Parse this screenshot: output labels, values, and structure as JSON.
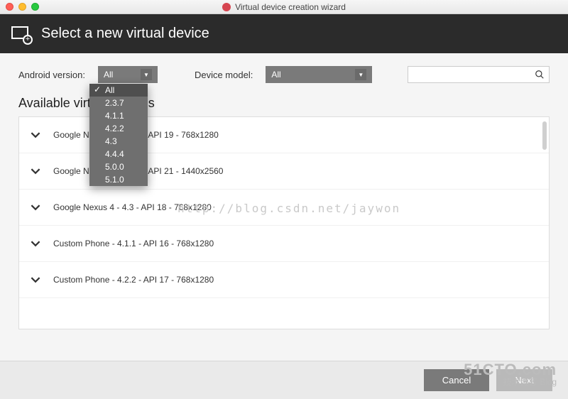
{
  "window": {
    "title": "Virtual device creation wizard"
  },
  "header": {
    "heading": "Select a new virtual device"
  },
  "filters": {
    "android_label": "Android version:",
    "android_selected": "All",
    "android_options": [
      "All",
      "2.3.7",
      "4.1.1",
      "4.2.2",
      "4.3",
      "4.4.4",
      "5.0.0",
      "5.1.0"
    ],
    "model_label": "Device model:",
    "model_selected": "All",
    "search_placeholder": ""
  },
  "section_title": "Available virtual devices",
  "devices": [
    {
      "text": "Google Nexus 7 - 4.4.4 - API 19 - 768x1280"
    },
    {
      "text": "Google Nexus 6 - 5.0.0 - API 21 - 1440x2560"
    },
    {
      "text": "Google Nexus 4 - 4.3 - API 18 - 768x1280"
    },
    {
      "text": "Custom Phone - 4.1.1 - API 16 - 768x1280"
    },
    {
      "text": "Custom Phone - 4.2.2 - API 17 - 768x1280"
    }
  ],
  "footer": {
    "cancel": "Cancel",
    "next": "Next"
  },
  "watermark": {
    "url": "http://blog.csdn.net/jaywon",
    "brand_line1": "51CTO.com",
    "brand_line2": "技术博客  Blog"
  }
}
